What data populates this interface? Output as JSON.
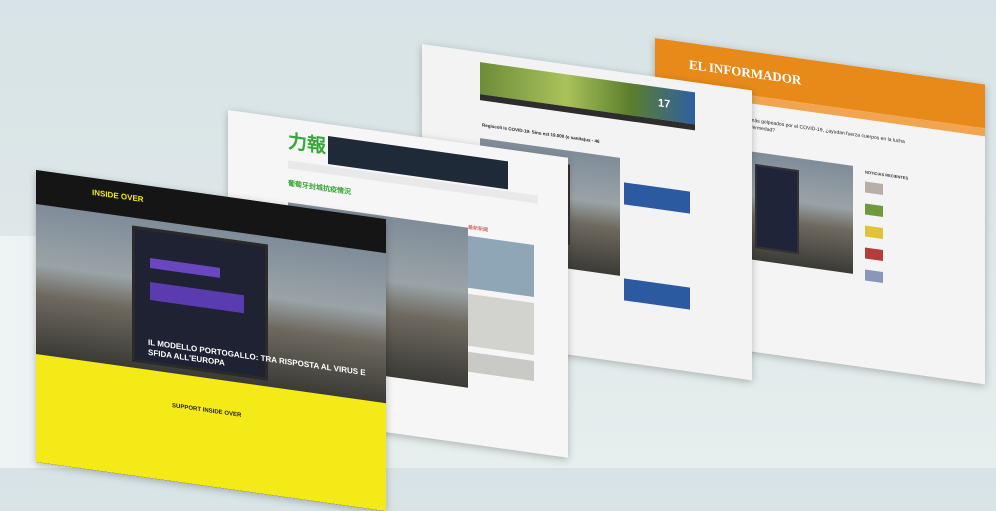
{
  "cards": {
    "informador": {
      "logo": "EL INFORMADOR",
      "headline": "Las paises más golpeados por el COVID-19, ¿ayudan fuerza cuerpos en la lucha contra la enfermedad?",
      "sidebar_title": "NOTICIAS RECIENTES",
      "accent": "#e88a1a"
    },
    "azorean": {
      "headline": "Regiscoli is COVID-19: Sinu est 19.000 (e sanita)us - 46",
      "temp": "17"
    },
    "chinese": {
      "logo": "力報",
      "headline": "葡萄牙封城抗疫情況",
      "tab_label": "最新新聞",
      "accent": "#38a838"
    },
    "inside": {
      "logo": "INSIDE OVER",
      "headline": "IL MODELLO PORTOGALLO: TRA RISPOSTA AL VIRUS E SFIDA ALL'EUROPA",
      "support": "SUPPORT INSIDE OVER",
      "accent": "#f4ea18"
    }
  }
}
